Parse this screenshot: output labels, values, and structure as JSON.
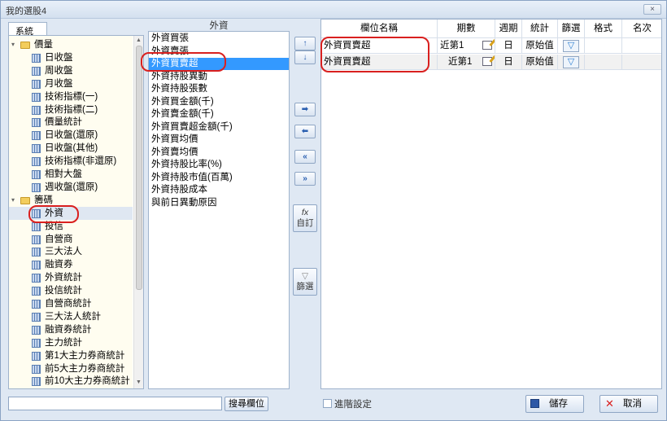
{
  "window": {
    "title": "我的選股4",
    "close_label": "×"
  },
  "left_panel": {
    "tab_label": "系統",
    "tree": [
      {
        "label": "價量",
        "type": "folder",
        "expanded": true
      },
      {
        "label": "日收盤",
        "type": "item"
      },
      {
        "label": "周收盤",
        "type": "item"
      },
      {
        "label": "月收盤",
        "type": "item"
      },
      {
        "label": "技術指標(一)",
        "type": "item"
      },
      {
        "label": "技術指標(二)",
        "type": "item"
      },
      {
        "label": "價量統計",
        "type": "item"
      },
      {
        "label": "日收盤(還原)",
        "type": "item"
      },
      {
        "label": "日收盤(其他)",
        "type": "item"
      },
      {
        "label": "技術指標(非還原)",
        "type": "item"
      },
      {
        "label": "相對大盤",
        "type": "item"
      },
      {
        "label": "週收盤(還原)",
        "type": "item"
      },
      {
        "label": "籌碼",
        "type": "folder",
        "expanded": true
      },
      {
        "label": "外資",
        "type": "item",
        "selected": true
      },
      {
        "label": "投信",
        "type": "item"
      },
      {
        "label": "自營商",
        "type": "item"
      },
      {
        "label": "三大法人",
        "type": "item"
      },
      {
        "label": "融資券",
        "type": "item"
      },
      {
        "label": "外資統計",
        "type": "item"
      },
      {
        "label": "投信統計",
        "type": "item"
      },
      {
        "label": "自營商統計",
        "type": "item"
      },
      {
        "label": "三大法人統計",
        "type": "item"
      },
      {
        "label": "融資券統計",
        "type": "item"
      },
      {
        "label": "主力統計",
        "type": "item"
      },
      {
        "label": "第1大主力券商統計",
        "type": "item"
      },
      {
        "label": "前5大主力券商統計",
        "type": "item"
      },
      {
        "label": "前10大主力券商統計",
        "type": "item"
      }
    ]
  },
  "middle_panel": {
    "header": "外資",
    "items": [
      "外資買張",
      "外資賣張",
      "外資買賣超",
      "外資持股異動",
      "外資持股張數",
      "外資買金額(千)",
      "外資賣金額(千)",
      "外資買賣超金額(千)",
      "外資買均價",
      "外資賣均價",
      "外資持股比率(%)",
      "外資持股市值(百萬)",
      "外資持股成本",
      "與前日異動原因"
    ],
    "selected_index": 2
  },
  "arrows": {
    "up": "↑",
    "down": "↓",
    "add": "➡",
    "remove": "⬅",
    "add_all": "»",
    "remove_all": "«",
    "custom_top": "fx",
    "custom_label": "自訂",
    "filter_top": "▽",
    "filter_label": "篩選"
  },
  "grid": {
    "columns": [
      "欄位名稱",
      "期數",
      "週期",
      "統計",
      "篩選",
      "格式",
      "名次"
    ],
    "rows": [
      {
        "name": "外資買賣超",
        "period": "近第1",
        "cycle": "日",
        "stat": "原始值",
        "filter": "▽"
      },
      {
        "name": "外資買賣超",
        "period": "近第1",
        "cycle": "日",
        "stat": "原始值",
        "filter": "▽"
      }
    ]
  },
  "bottom": {
    "search_placeholder": "",
    "search_button": "搜尋欄位",
    "advanced_label": "進階設定",
    "save_label": "儲存",
    "cancel_label": "取消"
  },
  "colors": {
    "highlight_oval": "#d9201f",
    "selected_row": "#3399ff",
    "tree_background": "#fffdf0"
  }
}
